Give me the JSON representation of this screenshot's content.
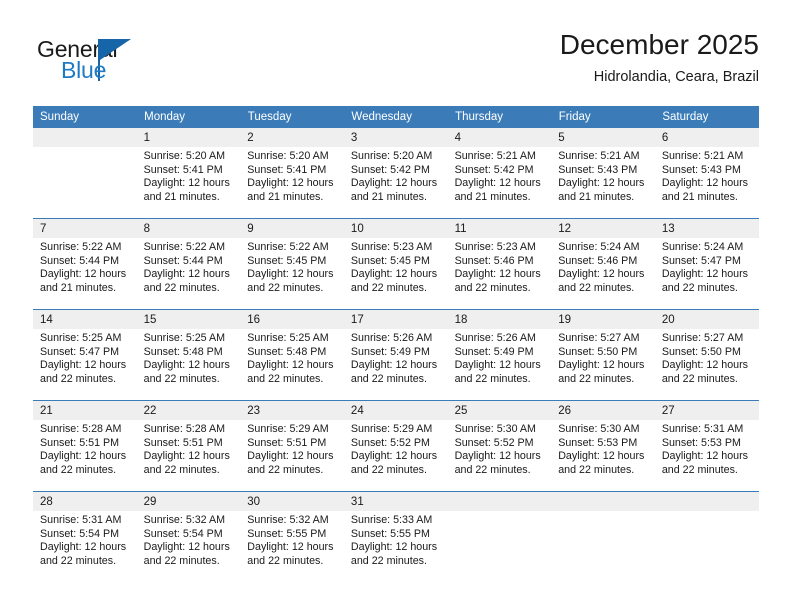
{
  "logo": {
    "word_one": "General",
    "word_two": "Blue",
    "triangle_color": "#1565a8",
    "blue_color": "#1f7ac4"
  },
  "header": {
    "month_title": "December 2025",
    "location": "Hidrolandia, Ceara, Brazil"
  },
  "theme": {
    "header_blue": "#3b7cb8",
    "daynum_gray": "#efefef",
    "text": "#1a1a1a"
  },
  "weekday_headers": [
    "Sunday",
    "Monday",
    "Tuesday",
    "Wednesday",
    "Thursday",
    "Friday",
    "Saturday"
  ],
  "labels": {
    "sunrise": "Sunrise:",
    "sunset": "Sunset:",
    "daylight": "Daylight:"
  },
  "weeks": [
    [
      {
        "day": "",
        "sunrise": "",
        "sunset": "",
        "daylight_a": "",
        "daylight_b": "",
        "empty": true
      },
      {
        "day": "1",
        "sunrise": "Sunrise: 5:20 AM",
        "sunset": "Sunset: 5:41 PM",
        "daylight_a": "Daylight: 12 hours",
        "daylight_b": "and 21 minutes.",
        "empty": false
      },
      {
        "day": "2",
        "sunrise": "Sunrise: 5:20 AM",
        "sunset": "Sunset: 5:41 PM",
        "daylight_a": "Daylight: 12 hours",
        "daylight_b": "and 21 minutes.",
        "empty": false
      },
      {
        "day": "3",
        "sunrise": "Sunrise: 5:20 AM",
        "sunset": "Sunset: 5:42 PM",
        "daylight_a": "Daylight: 12 hours",
        "daylight_b": "and 21 minutes.",
        "empty": false
      },
      {
        "day": "4",
        "sunrise": "Sunrise: 5:21 AM",
        "sunset": "Sunset: 5:42 PM",
        "daylight_a": "Daylight: 12 hours",
        "daylight_b": "and 21 minutes.",
        "empty": false
      },
      {
        "day": "5",
        "sunrise": "Sunrise: 5:21 AM",
        "sunset": "Sunset: 5:43 PM",
        "daylight_a": "Daylight: 12 hours",
        "daylight_b": "and 21 minutes.",
        "empty": false
      },
      {
        "day": "6",
        "sunrise": "Sunrise: 5:21 AM",
        "sunset": "Sunset: 5:43 PM",
        "daylight_a": "Daylight: 12 hours",
        "daylight_b": "and 21 minutes.",
        "empty": false
      }
    ],
    [
      {
        "day": "7",
        "sunrise": "Sunrise: 5:22 AM",
        "sunset": "Sunset: 5:44 PM",
        "daylight_a": "Daylight: 12 hours",
        "daylight_b": "and 21 minutes.",
        "empty": false
      },
      {
        "day": "8",
        "sunrise": "Sunrise: 5:22 AM",
        "sunset": "Sunset: 5:44 PM",
        "daylight_a": "Daylight: 12 hours",
        "daylight_b": "and 22 minutes.",
        "empty": false
      },
      {
        "day": "9",
        "sunrise": "Sunrise: 5:22 AM",
        "sunset": "Sunset: 5:45 PM",
        "daylight_a": "Daylight: 12 hours",
        "daylight_b": "and 22 minutes.",
        "empty": false
      },
      {
        "day": "10",
        "sunrise": "Sunrise: 5:23 AM",
        "sunset": "Sunset: 5:45 PM",
        "daylight_a": "Daylight: 12 hours",
        "daylight_b": "and 22 minutes.",
        "empty": false
      },
      {
        "day": "11",
        "sunrise": "Sunrise: 5:23 AM",
        "sunset": "Sunset: 5:46 PM",
        "daylight_a": "Daylight: 12 hours",
        "daylight_b": "and 22 minutes.",
        "empty": false
      },
      {
        "day": "12",
        "sunrise": "Sunrise: 5:24 AM",
        "sunset": "Sunset: 5:46 PM",
        "daylight_a": "Daylight: 12 hours",
        "daylight_b": "and 22 minutes.",
        "empty": false
      },
      {
        "day": "13",
        "sunrise": "Sunrise: 5:24 AM",
        "sunset": "Sunset: 5:47 PM",
        "daylight_a": "Daylight: 12 hours",
        "daylight_b": "and 22 minutes.",
        "empty": false
      }
    ],
    [
      {
        "day": "14",
        "sunrise": "Sunrise: 5:25 AM",
        "sunset": "Sunset: 5:47 PM",
        "daylight_a": "Daylight: 12 hours",
        "daylight_b": "and 22 minutes.",
        "empty": false
      },
      {
        "day": "15",
        "sunrise": "Sunrise: 5:25 AM",
        "sunset": "Sunset: 5:48 PM",
        "daylight_a": "Daylight: 12 hours",
        "daylight_b": "and 22 minutes.",
        "empty": false
      },
      {
        "day": "16",
        "sunrise": "Sunrise: 5:25 AM",
        "sunset": "Sunset: 5:48 PM",
        "daylight_a": "Daylight: 12 hours",
        "daylight_b": "and 22 minutes.",
        "empty": false
      },
      {
        "day": "17",
        "sunrise": "Sunrise: 5:26 AM",
        "sunset": "Sunset: 5:49 PM",
        "daylight_a": "Daylight: 12 hours",
        "daylight_b": "and 22 minutes.",
        "empty": false
      },
      {
        "day": "18",
        "sunrise": "Sunrise: 5:26 AM",
        "sunset": "Sunset: 5:49 PM",
        "daylight_a": "Daylight: 12 hours",
        "daylight_b": "and 22 minutes.",
        "empty": false
      },
      {
        "day": "19",
        "sunrise": "Sunrise: 5:27 AM",
        "sunset": "Sunset: 5:50 PM",
        "daylight_a": "Daylight: 12 hours",
        "daylight_b": "and 22 minutes.",
        "empty": false
      },
      {
        "day": "20",
        "sunrise": "Sunrise: 5:27 AM",
        "sunset": "Sunset: 5:50 PM",
        "daylight_a": "Daylight: 12 hours",
        "daylight_b": "and 22 minutes.",
        "empty": false
      }
    ],
    [
      {
        "day": "21",
        "sunrise": "Sunrise: 5:28 AM",
        "sunset": "Sunset: 5:51 PM",
        "daylight_a": "Daylight: 12 hours",
        "daylight_b": "and 22 minutes.",
        "empty": false
      },
      {
        "day": "22",
        "sunrise": "Sunrise: 5:28 AM",
        "sunset": "Sunset: 5:51 PM",
        "daylight_a": "Daylight: 12 hours",
        "daylight_b": "and 22 minutes.",
        "empty": false
      },
      {
        "day": "23",
        "sunrise": "Sunrise: 5:29 AM",
        "sunset": "Sunset: 5:51 PM",
        "daylight_a": "Daylight: 12 hours",
        "daylight_b": "and 22 minutes.",
        "empty": false
      },
      {
        "day": "24",
        "sunrise": "Sunrise: 5:29 AM",
        "sunset": "Sunset: 5:52 PM",
        "daylight_a": "Daylight: 12 hours",
        "daylight_b": "and 22 minutes.",
        "empty": false
      },
      {
        "day": "25",
        "sunrise": "Sunrise: 5:30 AM",
        "sunset": "Sunset: 5:52 PM",
        "daylight_a": "Daylight: 12 hours",
        "daylight_b": "and 22 minutes.",
        "empty": false
      },
      {
        "day": "26",
        "sunrise": "Sunrise: 5:30 AM",
        "sunset": "Sunset: 5:53 PM",
        "daylight_a": "Daylight: 12 hours",
        "daylight_b": "and 22 minutes.",
        "empty": false
      },
      {
        "day": "27",
        "sunrise": "Sunrise: 5:31 AM",
        "sunset": "Sunset: 5:53 PM",
        "daylight_a": "Daylight: 12 hours",
        "daylight_b": "and 22 minutes.",
        "empty": false
      }
    ],
    [
      {
        "day": "28",
        "sunrise": "Sunrise: 5:31 AM",
        "sunset": "Sunset: 5:54 PM",
        "daylight_a": "Daylight: 12 hours",
        "daylight_b": "and 22 minutes.",
        "empty": false
      },
      {
        "day": "29",
        "sunrise": "Sunrise: 5:32 AM",
        "sunset": "Sunset: 5:54 PM",
        "daylight_a": "Daylight: 12 hours",
        "daylight_b": "and 22 minutes.",
        "empty": false
      },
      {
        "day": "30",
        "sunrise": "Sunrise: 5:32 AM",
        "sunset": "Sunset: 5:55 PM",
        "daylight_a": "Daylight: 12 hours",
        "daylight_b": "and 22 minutes.",
        "empty": false
      },
      {
        "day": "31",
        "sunrise": "Sunrise: 5:33 AM",
        "sunset": "Sunset: 5:55 PM",
        "daylight_a": "Daylight: 12 hours",
        "daylight_b": "and 22 minutes.",
        "empty": false
      },
      {
        "day": "",
        "sunrise": "",
        "sunset": "",
        "daylight_a": "",
        "daylight_b": "",
        "empty": true
      },
      {
        "day": "",
        "sunrise": "",
        "sunset": "",
        "daylight_a": "",
        "daylight_b": "",
        "empty": true
      },
      {
        "day": "",
        "sunrise": "",
        "sunset": "",
        "daylight_a": "",
        "daylight_b": "",
        "empty": true
      }
    ]
  ]
}
